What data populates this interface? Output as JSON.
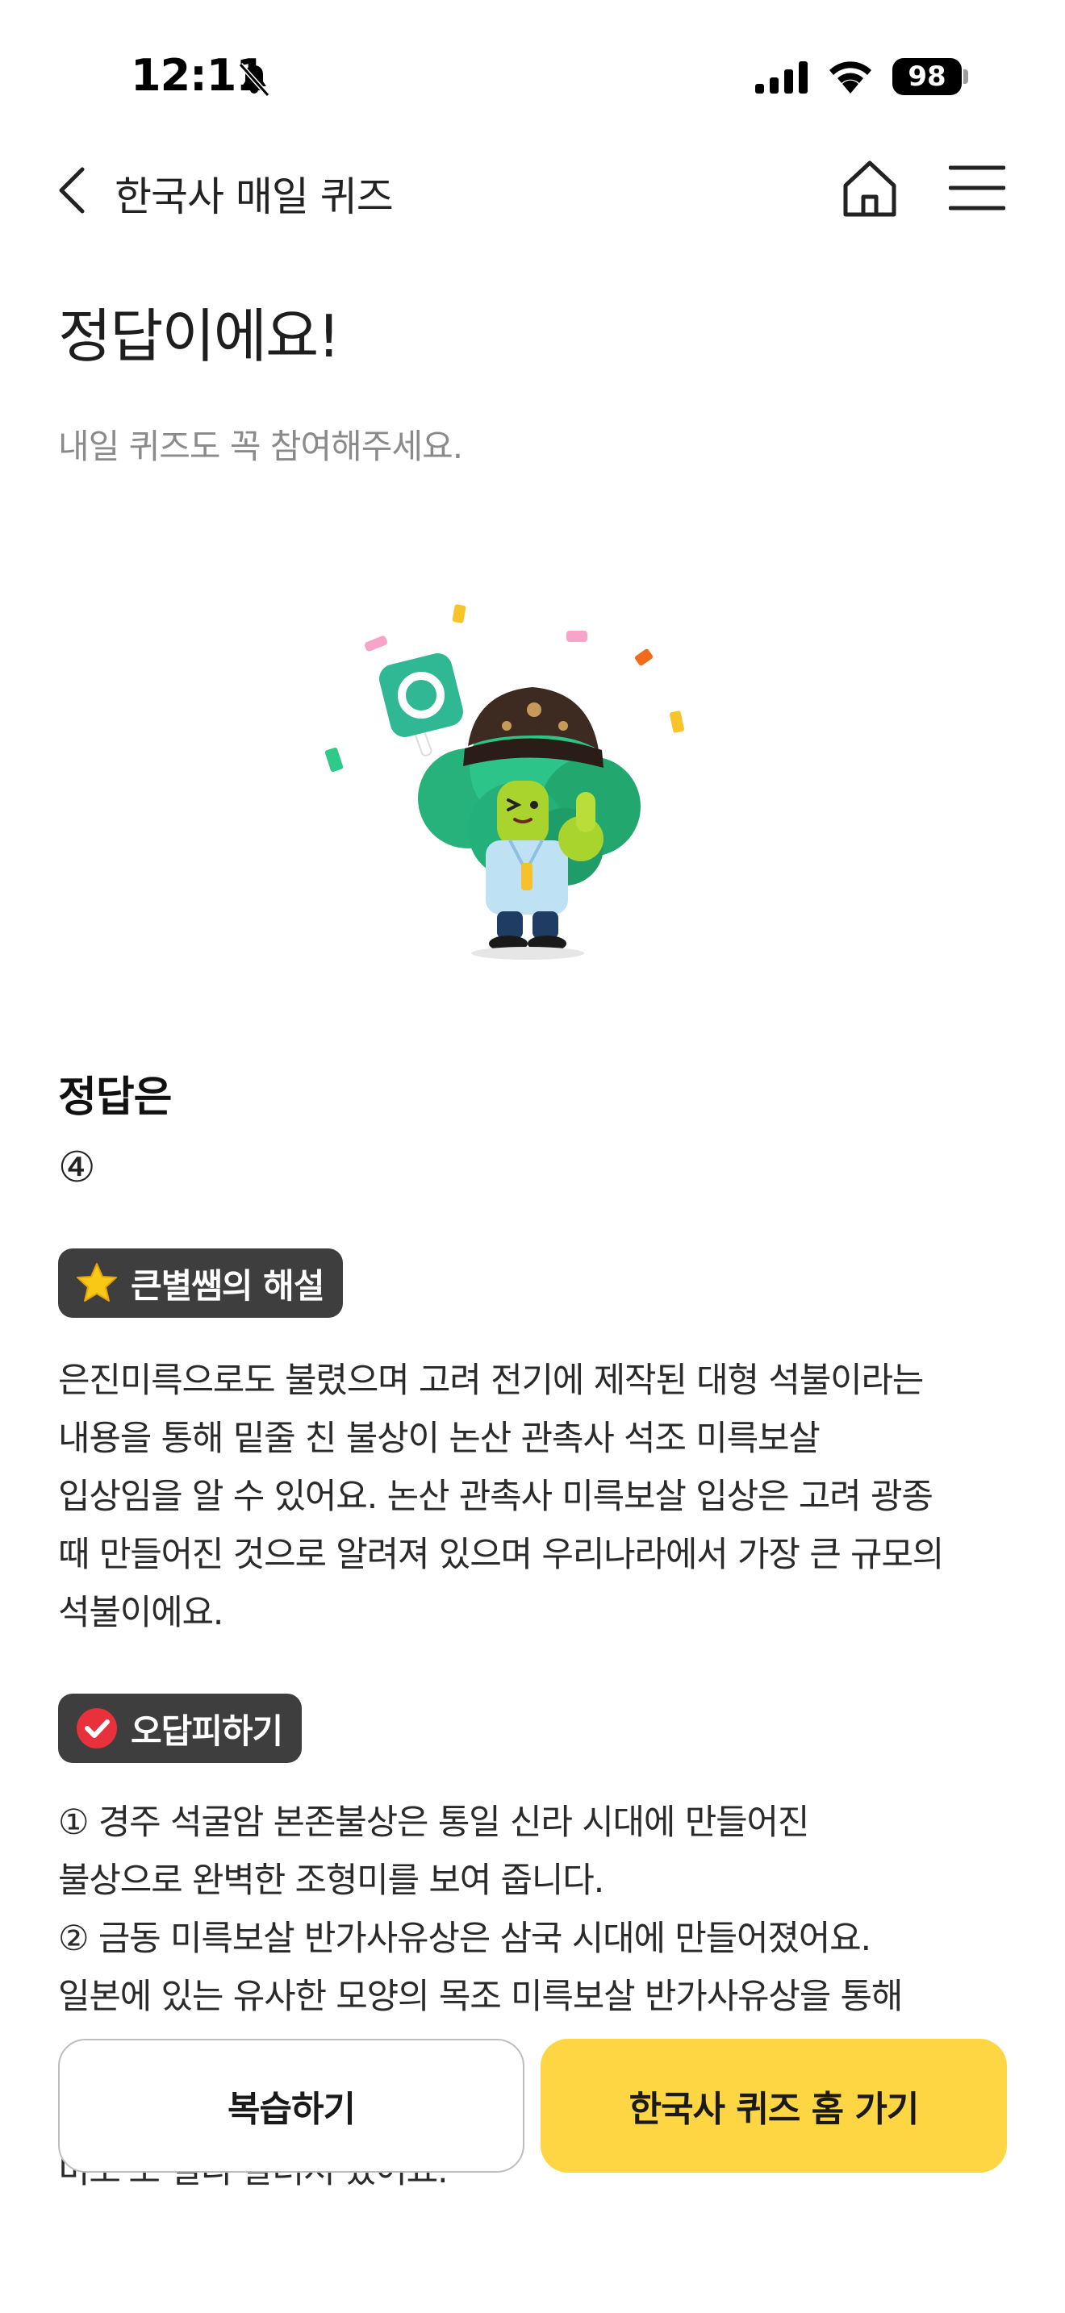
{
  "status_bar": {
    "time": "12:11",
    "battery": "98",
    "icons": [
      "bell-off-icon",
      "signal-icon",
      "wifi-icon",
      "battery-icon"
    ]
  },
  "nav": {
    "title": "한국사 매일 퀴즈",
    "icons": [
      "chevron-left-icon",
      "home-icon",
      "menu-icon"
    ]
  },
  "result": {
    "title": "정답이에요!",
    "subtitle": "내일 퀴즈도 꼭 참여해주세요."
  },
  "mascot": {
    "icon": "celebrating-mascot-illustration"
  },
  "answer": {
    "heading": "정답은",
    "value": "④"
  },
  "explanation": {
    "badge_label": "큰별쌤의 해설",
    "badge_icon": "star-icon",
    "lines": [
      "은진미륵으로도 불렸으며 고려 전기에 제작된 대형 석불이라는",
      "내용을 통해 밑줄 친 불상이 논산 관촉사 석조 미륵보살",
      "입상임을 알 수 있어요. 논산 관촉사 미륵보살 입상은 고려 광종",
      "때 만들어진 것으로 알려져 있으며 우리나라에서 가장 큰 규모의",
      "석불이에요."
    ]
  },
  "wrong_answers": {
    "badge_label": "오답피하기",
    "badge_icon": "check-circle-icon",
    "lines": [
      "① 경주 석굴암 본존불상은 통일 신라 시대에 만들어진",
      "불상으로 완벽한 조형미를 보여 줍니다.",
      "② 금동 미륵보살 반가사유상은 삼국 시대에 만들어졌어요.",
      "일본에 있는 유사한 모양의 목조 미륵보살 반가사유상을 통해",
      "",
      "",
      "미소'로 널리 알려져 있어요."
    ]
  },
  "buttons": {
    "review": "복습하기",
    "go_home": "한국사 퀴즈 홈 가기"
  },
  "colors": {
    "accent_yellow": "#fed543",
    "badge_bg": "#3e3e3e",
    "subtitle_gray": "#8a8a8a",
    "mascot_green": "#22b478",
    "check_red": "#e8313b",
    "star_yellow": "#f9c816"
  }
}
